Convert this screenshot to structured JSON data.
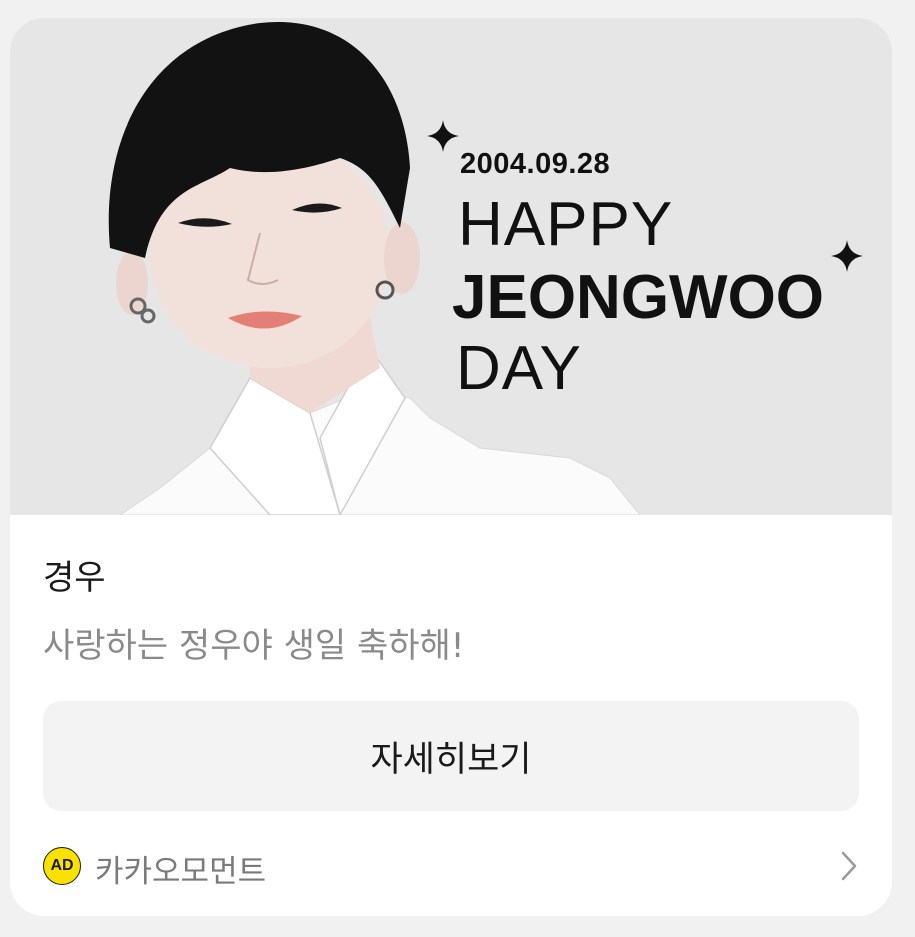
{
  "banner": {
    "date": "2004.09.28",
    "line1": "HAPPY",
    "line2": "JEONGWOO",
    "line3": "DAY"
  },
  "card": {
    "sender": "경우",
    "message": "사랑하는 정우야 생일 축하해!",
    "detail_button_label": "자세히보기"
  },
  "footer": {
    "ad_badge": "AD",
    "advertiser": "카카오모먼트",
    "chevron_icon": "chevron-right-icon"
  },
  "colors": {
    "page_bg": "#f1f1f1",
    "card_bg": "#ffffff",
    "banner_bg": "#e6e6e6",
    "button_bg": "#f3f3f3",
    "ad_badge_bg": "#fae100",
    "message_text": "#8a8a8a"
  }
}
